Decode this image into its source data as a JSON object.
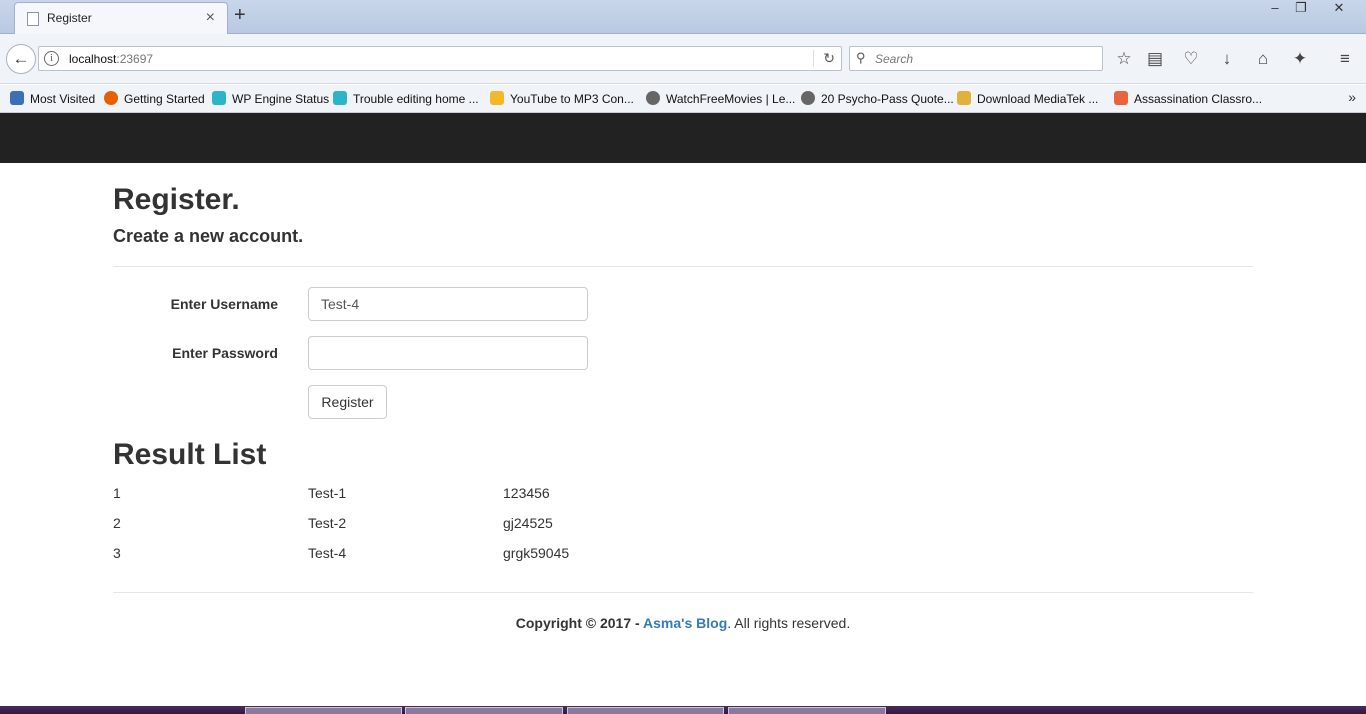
{
  "browser": {
    "tab_title": "Register",
    "url_host": "localhost",
    "url_port": ":23697",
    "search_placeholder": "Search",
    "bookmarks": [
      {
        "label": "Most Visited",
        "color": "#3b6fb6"
      },
      {
        "label": "Getting Started",
        "color": "#e66000"
      },
      {
        "label": "WP Engine Status",
        "color": "#2bb5c7"
      },
      {
        "label": "Trouble editing home ...",
        "color": "#2bb5c7"
      },
      {
        "label": "YouTube to MP3 Con...",
        "color": "#f2b827"
      },
      {
        "label": "WatchFreeMovies | Le...",
        "color": "#666666"
      },
      {
        "label": "20 Psycho-Pass Quote...",
        "color": "#666666"
      },
      {
        "label": "Download MediaTek ...",
        "color": "#e0b23a"
      },
      {
        "label": "Assassination Classro...",
        "color": "#e8643c"
      }
    ]
  },
  "page": {
    "title": "Register.",
    "subtitle": "Create a new account.",
    "form": {
      "username_label": "Enter Username",
      "username_value": "Test-4",
      "password_label": "Enter Password",
      "password_value": "",
      "register_button": "Register"
    },
    "result_title": "Result List",
    "results": [
      {
        "id": "1",
        "username": "Test-1",
        "password": "123456"
      },
      {
        "id": "2",
        "username": "Test-2",
        "password": "gj24525"
      },
      {
        "id": "3",
        "username": "Test-4",
        "password": "grgk59045"
      }
    ],
    "footer": {
      "prefix": "Copyright © 2017 - ",
      "link": "Asma's Blog",
      "suffix": ". All rights reserved."
    }
  }
}
